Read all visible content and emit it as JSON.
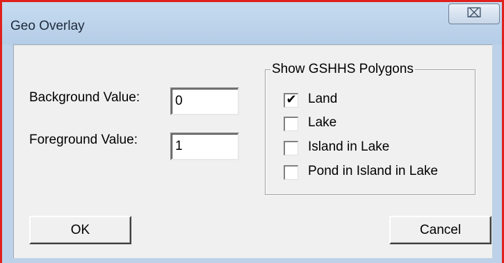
{
  "window": {
    "title": "Geo Overlay",
    "close_glyph": "⌧",
    "accent_border": "#e0201c"
  },
  "form": {
    "background_label": "Background Value:",
    "background_value": "0",
    "foreground_label": "Foreground Value:",
    "foreground_value": "1"
  },
  "polygons": {
    "legend": "Show GSHHS Polygons",
    "items": [
      {
        "label": "Land",
        "checked": true
      },
      {
        "label": "Lake",
        "checked": false
      },
      {
        "label": "Island in Lake",
        "checked": false
      },
      {
        "label": "Pond in Island in Lake",
        "checked": false
      }
    ]
  },
  "buttons": {
    "ok_label": "OK",
    "cancel_label": "Cancel"
  },
  "icons": {
    "close": "close-icon",
    "check": "checkmark-icon"
  }
}
